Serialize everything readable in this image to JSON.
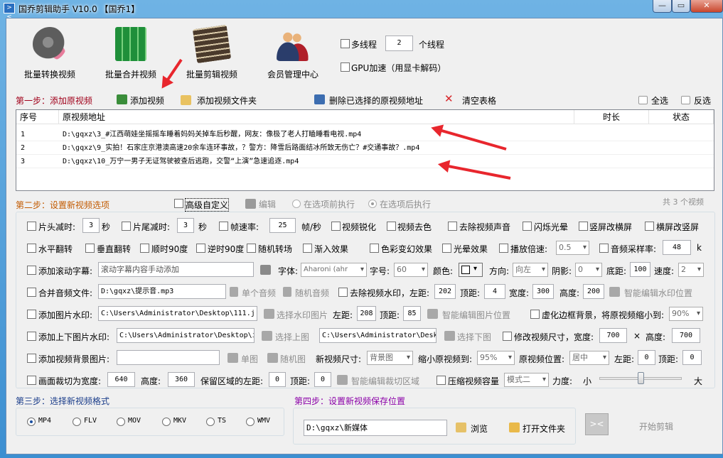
{
  "window": {
    "title": "国乔剪辑助手 V10.0  【国乔1】",
    "icon": "scissors-app-icon",
    "controls": [
      "minimize",
      "restore",
      "close"
    ]
  },
  "toolbar": {
    "batch_convert": "批量转换视频",
    "batch_merge": "批量合并视频",
    "batch_edit": "批量剪辑视频",
    "member_center": "会员管理中心",
    "multithread_label": "多线程",
    "thread_count": "2",
    "thread_unit": "个线程",
    "gpu_label": "GPU加速（用显卡解码）"
  },
  "step1": {
    "title": "第一步：添加原视频",
    "add_video": "添加视频",
    "add_folder": "添加视频文件夹",
    "delete_selected": "删除已选择的原视频地址",
    "clear_table": "清空表格",
    "select_all": "全选",
    "invert": "反选"
  },
  "table": {
    "headers": [
      "序号",
      "原视频地址",
      "时长",
      "状态"
    ],
    "rows": [
      {
        "no": "1",
        "path": "D:\\gqxz\\3_#江西萌娃坐摇摇车睡着妈妈关掉车后秒醒，网友：像极了老人打瞌睡看电视.mp4",
        "duration": "",
        "status": ""
      },
      {
        "no": "2",
        "path": "D:\\gqxz\\9_实拍！石家庄京港澳高速20余车连环事故，？警方：降雪后路面结冰所致无伤亡？#交通事故？.mp4",
        "duration": "",
        "status": ""
      },
      {
        "no": "3",
        "path": "D:\\gqxz\\10_万宁一男子无证驾驶被查后逃跑，交警“上演”急速追逐.mp4",
        "duration": "",
        "status": ""
      }
    ],
    "count_text": "共 3 个视频"
  },
  "step2": {
    "title": "第二步：设置新视频选项",
    "advanced_custom": "高级自定义",
    "edit": "编辑",
    "run_before": "在选项前执行",
    "run_after": "在选项后执行",
    "row1": {
      "head_cut": "片头减时:",
      "head_cut_value": "3",
      "sec1": "秒",
      "tail_cut": "片尾减时:",
      "tail_cut_value": "3",
      "sec2": "秒",
      "fps": "帧速率:",
      "fps_value": "25",
      "fps_unit": "帧/秒",
      "sharpen": "视频锐化",
      "decolor": "视频去色",
      "remove_audio": "去除视频声音",
      "flash": "闪烁光晕",
      "v2h": "竖屏改横屏",
      "h2v": "横屏改竖屏"
    },
    "row2": {
      "hflip": "水平翻转",
      "vflip": "垂直翻转",
      "rot90": "顺时90度",
      "rot_ccw90": "逆时90度",
      "random_transition": "随机转场",
      "fade_in": "渐入效果",
      "color_effect": "色彩变幻效果",
      "halo": "光晕效果",
      "speed": "播放倍速:",
      "speed_value": "0.5",
      "sample_rate": "音频采样率:",
      "sample_rate_value": "48",
      "sample_unit": "k"
    },
    "row3": {
      "scroll_text": "添加滚动字幕:",
      "scroll_text_placeholder": "滚动字幕内容手动添加",
      "font": "字体:",
      "font_value": "Aharoni (ahr",
      "size": "字号:",
      "size_value": "60",
      "color": "颜色:",
      "direction": "方向:",
      "direction_value": "向左",
      "shadow": "阴影:",
      "shadow_value": "0",
      "bottom": "底距:",
      "bottom_value": "100",
      "speed": "速度:",
      "speed_value": "2"
    },
    "row4": {
      "merge_audio": "合并音频文件:",
      "audio_path": "D:\\gqxz\\提示音.mp3",
      "single_audio": "单个音频",
      "random_audio": "随机音频",
      "remove_watermark": "去除视频水印，左距:",
      "wm_left": "202",
      "top": "顶距:",
      "wm_top": "4",
      "width": "宽度:",
      "wm_width": "300",
      "height": "高度:",
      "wm_height": "200",
      "smart_watermark": "智能编辑水印位置"
    },
    "row5": {
      "image_watermark": "添加图片水印:",
      "image_path": "C:\\Users\\Administrator\\Desktop\\111.j",
      "choose_image": "选择水印图片",
      "left": "左距:",
      "left_value": "208",
      "top": "顶距:",
      "top_value": "85",
      "smart_image": "智能编辑图片位置",
      "blur_border": "虚化边框背景，将原视频缩小到:",
      "blur_value": "90%"
    },
    "row6": {
      "top_bottom_image": "添加上下图片水印:",
      "top_path": "C:\\Users\\Administrator\\Desktop\\i",
      "choose_top": "选择上图",
      "bottom_path": "C:\\Users\\Administrator\\Desk",
      "choose_bottom": "选择下图",
      "resize": "修改视频尺寸，宽度:",
      "resize_width": "700",
      "times": "×",
      "height": "高度:",
      "resize_height": "700"
    },
    "row7": {
      "bg_image": "添加视频背景图片:",
      "single_image": "单图",
      "random_image": "随机图",
      "new_size": "新视频尺寸:",
      "new_size_value": "背景图",
      "shrink": "缩小原视频到:",
      "shrink_value": "95%",
      "position": "原视频位置:",
      "position_value": "居中",
      "left": "左距:",
      "left_value": "0",
      "top": "顶距:",
      "top_value": "0"
    },
    "row8": {
      "crop": "画面裁切为宽度:",
      "crop_width": "640",
      "height": "高度:",
      "crop_height": "360",
      "keep_left": "保留区域的左距:",
      "keep_left_value": "0",
      "top": "顶距:",
      "keep_top_value": "0",
      "smart_crop": "智能编辑裁切区域",
      "compress": "压缩视频容量",
      "mode_value": "模式二",
      "strength": "力度:",
      "small": "小",
      "large": "大",
      "strength_level": 0.5
    }
  },
  "step3": {
    "title": "第三步：选择新视频格式",
    "formats": [
      "MP4",
      "FLV",
      "MOV",
      "MKV",
      "TS",
      "WMV"
    ],
    "selected": "MP4"
  },
  "step4": {
    "title": "第四步：设置新视频保存位置",
    "save_path": "D:\\gqxz\\新媒体",
    "browse": "浏览",
    "open_folder": "打开文件夹",
    "start": "开始剪辑"
  },
  "colors": {
    "step_title": "#a0001a",
    "step4_title": "#8b00a8",
    "arrow": "#e8262d",
    "title_bar": "#3c8fd1"
  }
}
